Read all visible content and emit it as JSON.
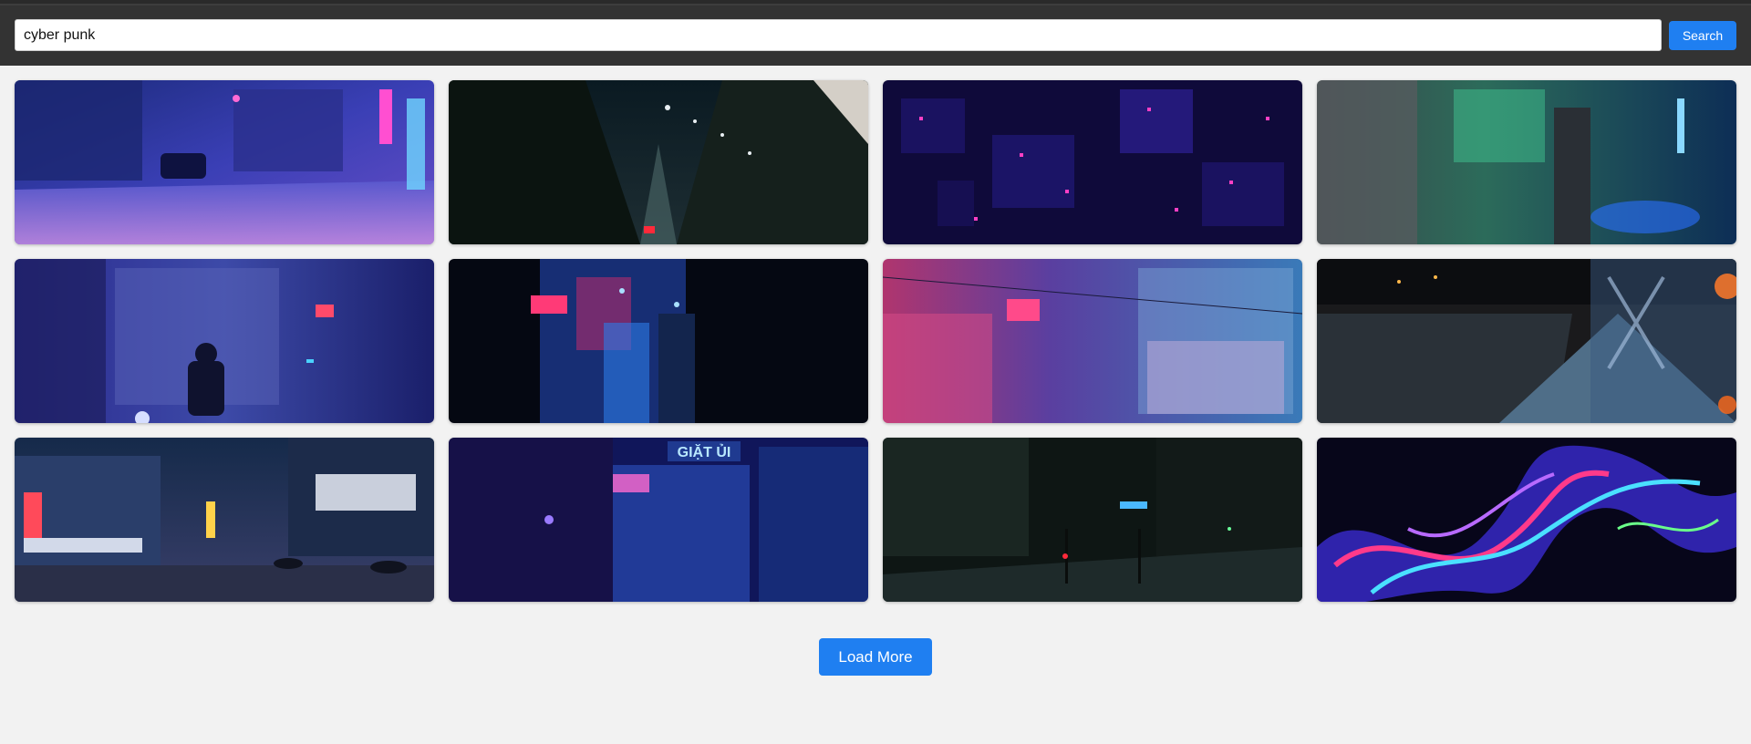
{
  "search": {
    "value": "cyber punk",
    "button_label": "Search"
  },
  "gallery": {
    "items": [
      {
        "subject": "neon-street-with-car"
      },
      {
        "subject": "city-street-night"
      },
      {
        "subject": "aerial-city-neon"
      },
      {
        "subject": "green-blue-alley"
      },
      {
        "subject": "person-in-blue-alley"
      },
      {
        "subject": "dark-neon-corridor"
      },
      {
        "subject": "pink-blue-alley-signs"
      },
      {
        "subject": "bridge-walkway-night"
      },
      {
        "subject": "tokyo-street-rain"
      },
      {
        "subject": "blue-street-signs"
      },
      {
        "subject": "dark-green-street"
      },
      {
        "subject": "glass-neon-abstract"
      }
    ]
  },
  "footer": {
    "load_more_label": "Load More"
  },
  "colors": {
    "accent": "#1f7ff1",
    "topbar": "#333333",
    "background": "#f2f2f2"
  }
}
